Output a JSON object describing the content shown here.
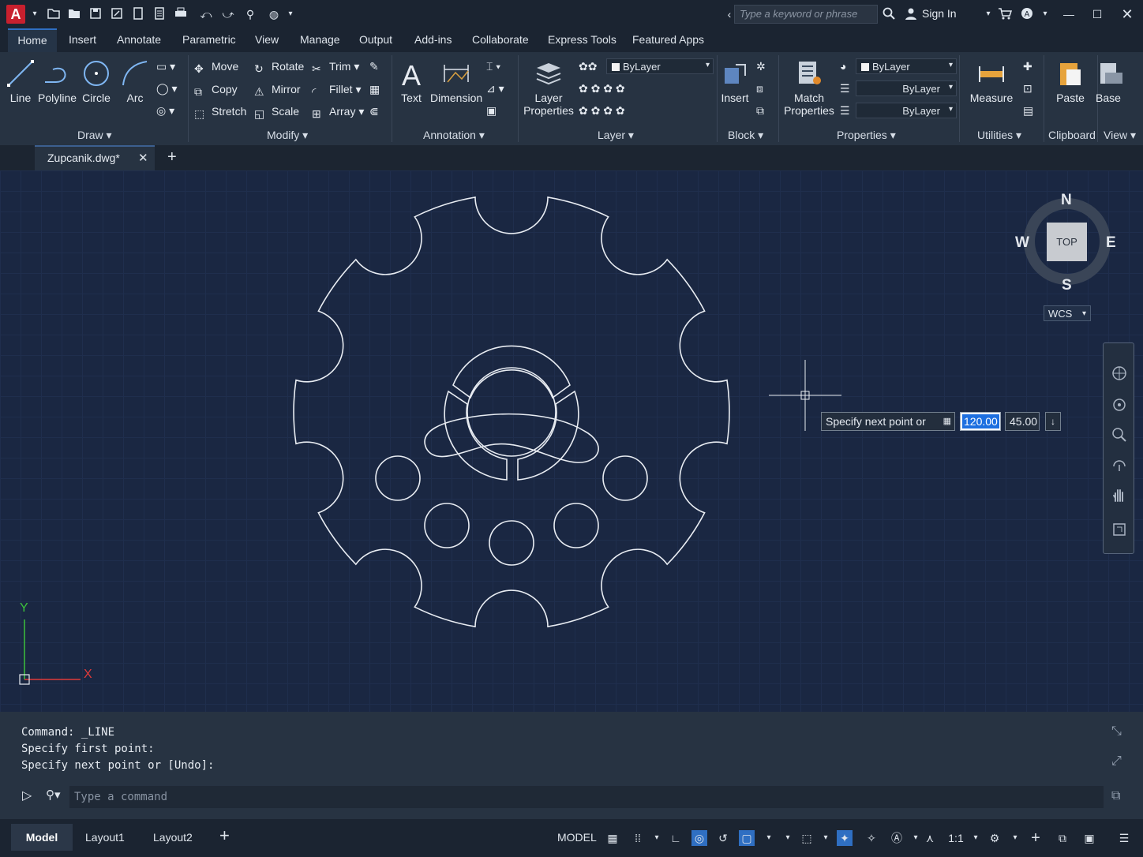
{
  "app": {
    "logo": "A"
  },
  "search": {
    "placeholder": "Type a keyword or phrase"
  },
  "account": {
    "sign_in": "Sign In"
  },
  "ribbon_tabs": [
    "Home",
    "Insert",
    "Annotate",
    "Parametric",
    "View",
    "Manage",
    "Output",
    "Add-ins",
    "Collaborate",
    "Express Tools",
    "Featured Apps"
  ],
  "draw": {
    "line": "Line",
    "polyline": "Polyline",
    "circle": "Circle",
    "arc": "Arc",
    "panel": "Draw"
  },
  "modify": {
    "move": "Move",
    "rotate": "Rotate",
    "trim": "Trim",
    "copy": "Copy",
    "mirror": "Mirror",
    "fillet": "Fillet",
    "stretch": "Stretch",
    "scale": "Scale",
    "array": "Array",
    "panel": "Modify"
  },
  "annotation": {
    "text": "Text",
    "dimension": "Dimension",
    "panel": "Annotation"
  },
  "layer": {
    "layer_properties_1": "Layer",
    "layer_properties_2": "Properties",
    "current": "ByLayer",
    "panel": "Layer"
  },
  "block": {
    "insert": "Insert",
    "panel": "Block"
  },
  "properties": {
    "match_1": "Match",
    "match_2": "Properties",
    "color": "ByLayer",
    "linetype": "ByLayer",
    "lineweight": "ByLayer",
    "panel": "Properties"
  },
  "utilities": {
    "measure": "Measure",
    "panel": "Utilities"
  },
  "clipboard": {
    "paste": "Paste",
    "panel": "Clipboard"
  },
  "view": {
    "base": "Base",
    "panel": "View"
  },
  "file_tab": {
    "name": "Zupcanik.dwg*"
  },
  "viewcube": {
    "n": "N",
    "s": "S",
    "e": "E",
    "w": "W",
    "face": "TOP",
    "ucs": "WCS"
  },
  "ucs_icon": {
    "x": "X",
    "y": "Y"
  },
  "dynamic_input": {
    "prompt": "Specify next point or",
    "length": "120.00",
    "angle": "45.00"
  },
  "command": {
    "history": [
      "Command:  _LINE",
      "Specify first point:",
      "Specify next point or [Undo]:"
    ],
    "placeholder": "Type a command"
  },
  "layouts": [
    "Model",
    "Layout1",
    "Layout2"
  ],
  "status": {
    "space": "MODEL",
    "scale": "1:1"
  },
  "colors": {
    "canvas": "#1a2742",
    "ribbon": "#273342",
    "accent": "#2f6fc2",
    "ucs_x": "#e03a3a",
    "ucs_y": "#3cc23c"
  }
}
